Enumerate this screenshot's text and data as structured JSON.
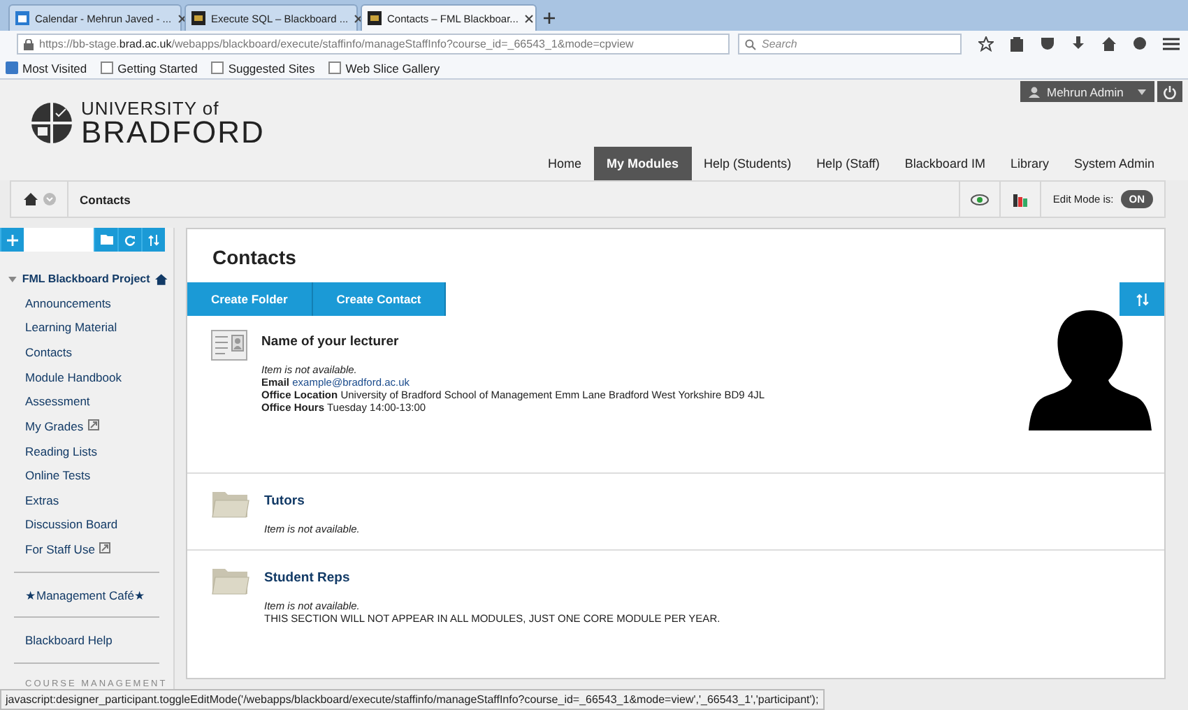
{
  "browser": {
    "tabs": [
      {
        "title": "Calendar - Mehrun Javed - ...",
        "selected": false,
        "kind": "calendar"
      },
      {
        "title": "Execute SQL – Blackboard ...",
        "selected": false,
        "kind": "bb"
      },
      {
        "title": "Contacts – FML Blackboar...",
        "selected": true,
        "kind": "bb"
      }
    ],
    "url_prefix": "https://bb-stage.",
    "url_domain": "brad.ac.uk",
    "url_rest": "/webapps/blackboard/execute/staffinfo/manageStaffInfo?course_id=_66543_1&mode=cpview",
    "search": {
      "placeholder": "Search"
    },
    "bookmarks": [
      {
        "label": "Most Visited",
        "kind": "special"
      },
      {
        "label": "Getting Started",
        "kind": "page"
      },
      {
        "label": "Suggested Sites",
        "kind": "page"
      },
      {
        "label": "Web Slice Gallery",
        "kind": "page"
      }
    ]
  },
  "header": {
    "logo": {
      "line_1": "UNIVERSITY of",
      "line_2": "BRADFORD"
    },
    "user": "Mehrun Admin",
    "nav": [
      {
        "label": "Home",
        "selected": false
      },
      {
        "label": "My Modules",
        "selected": true
      },
      {
        "label": "Help (Students)",
        "selected": false
      },
      {
        "label": "Help (Staff)",
        "selected": false
      },
      {
        "label": "Blackboard IM",
        "selected": false
      },
      {
        "label": "Library",
        "selected": false
      },
      {
        "label": "System Admin",
        "selected": false
      }
    ]
  },
  "breadcrumb": {
    "current": "Contacts",
    "edit_mode": {
      "label": "Edit Mode is:",
      "value": "ON",
      "on": true
    }
  },
  "sidebar": {
    "course": {
      "title": "FML Blackboard Project",
      "expanded": true
    },
    "items": [
      {
        "label": "Announcements",
        "external": false
      },
      {
        "label": "Learning Material",
        "external": false
      },
      {
        "label": "Contacts",
        "external": false
      },
      {
        "label": "Module Handbook",
        "external": false
      },
      {
        "label": "Assessment",
        "external": false
      },
      {
        "label": "My Grades",
        "external": true
      },
      {
        "label": "Reading Lists",
        "external": false
      },
      {
        "label": "Online Tests",
        "external": false
      },
      {
        "label": "Extras",
        "external": false
      },
      {
        "label": "Discussion Board",
        "external": false
      },
      {
        "label": "For Staff Use",
        "external": true
      }
    ],
    "extra_items": [
      "★Management Café★",
      "Blackboard Help"
    ],
    "section_heading": "COURSE MANAGEMENT"
  },
  "content": {
    "title": "Contacts",
    "actions": [
      "Create Folder",
      "Create Contact"
    ],
    "entries": [
      {
        "kind": "contact",
        "title": "Name of your lecturer",
        "availability": "Item is not available.",
        "fields": [
          {
            "label": "Email",
            "value": "example@bradford.ac.uk",
            "link": true
          },
          {
            "label": "Office Location",
            "value": "University of Bradford School of Management Emm Lane Bradford West Yorkshire  BD9 4JL",
            "link": false
          },
          {
            "label": "Office Hours",
            "value": "Tuesday 14:00-13:00",
            "link": false
          }
        ]
      },
      {
        "kind": "folder",
        "title": "Tutors",
        "availability": "Item is not available."
      },
      {
        "kind": "folder",
        "title": "Student Reps",
        "availability": "Item is not available.",
        "description": "THIS SECTION WILL NOT APPEAR IN ALL MODULES, JUST ONE CORE MODULE PER YEAR."
      }
    ]
  },
  "status_bar": "javascript:designer_participant.toggleEditMode('/webapps/blackboard/execute/staffinfo/manageStaffInfo?course_id=_66543_1&mode=view','_66543_1','participant');"
}
